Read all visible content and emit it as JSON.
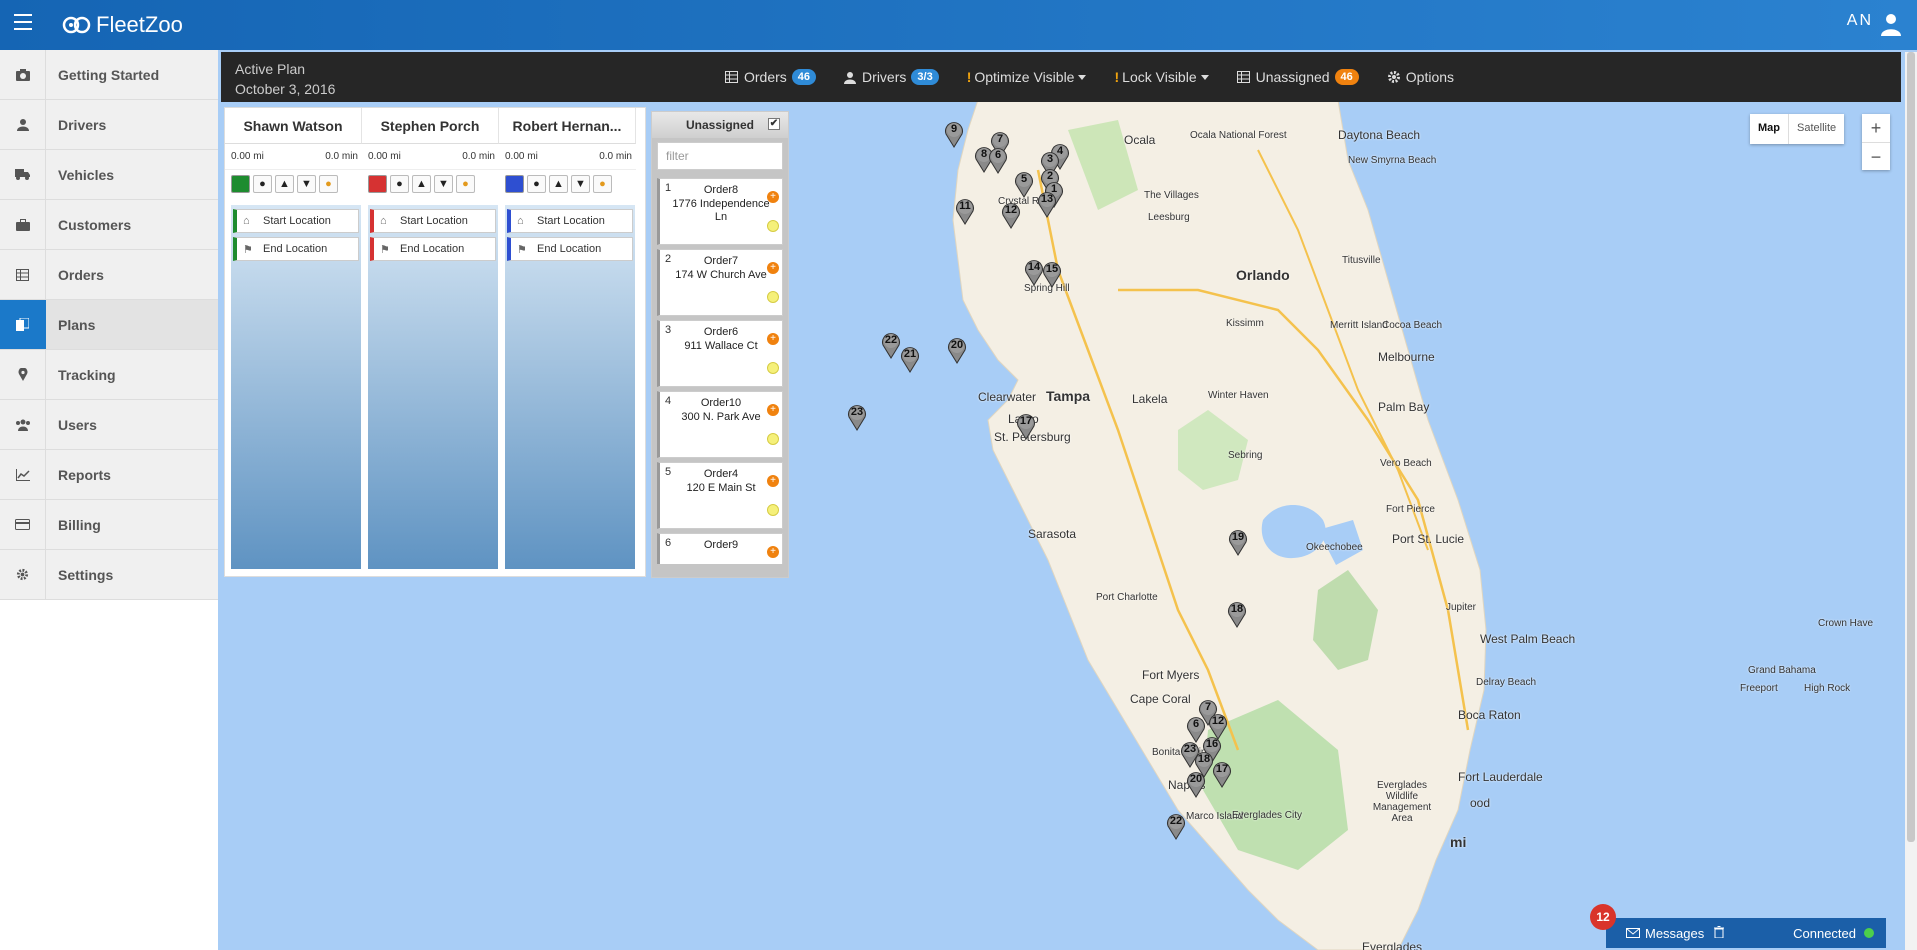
{
  "app": {
    "name": "FleetZoo",
    "user_initials": "AN"
  },
  "sidebar": {
    "items": [
      {
        "label": "Getting Started",
        "icon": "getting-started-icon",
        "active": false
      },
      {
        "label": "Drivers",
        "icon": "driver-icon",
        "active": false
      },
      {
        "label": "Vehicles",
        "icon": "truck-icon",
        "active": false
      },
      {
        "label": "Customers",
        "icon": "briefcase-icon",
        "active": false
      },
      {
        "label": "Orders",
        "icon": "grid-icon",
        "active": false
      },
      {
        "label": "Plans",
        "icon": "plans-icon",
        "active": true
      },
      {
        "label": "Tracking",
        "icon": "map-marker-icon",
        "active": false
      },
      {
        "label": "Users",
        "icon": "users-icon",
        "active": false
      },
      {
        "label": "Reports",
        "icon": "line-chart-icon",
        "active": false
      },
      {
        "label": "Billing",
        "icon": "credit-card-icon",
        "active": false
      },
      {
        "label": "Settings",
        "icon": "gear-icon",
        "active": false
      }
    ]
  },
  "planbar": {
    "title": "Active Plan",
    "date": "October 3, 2016",
    "orders_label": "Orders",
    "orders_count": "46",
    "drivers_label": "Drivers",
    "drivers_count": "3/3",
    "optimize_label": "Optimize Visible",
    "lock_label": "Lock Visible",
    "unassigned_label": "Unassigned",
    "unassigned_count": "46",
    "options_label": "Options"
  },
  "drivers": [
    {
      "name": "Shawn Watson",
      "distance": "0.00 mi",
      "time": "0.0 min",
      "color": "#1e8c2f",
      "start": "Start Location",
      "end": "End Location"
    },
    {
      "name": "Stephen Porch",
      "distance": "0.00 mi",
      "time": "0.0 min",
      "color": "#d63232",
      "start": "Start Location",
      "end": "End Location"
    },
    {
      "name": "Robert Hernan...",
      "distance": "0.00 mi",
      "time": "0.0 min",
      "color": "#2e4fd1",
      "start": "Start Location",
      "end": "End Location"
    }
  ],
  "unassigned": {
    "title": "Unassigned",
    "checkbox_mark": "✔",
    "filter_placeholder": "filter",
    "orders": [
      {
        "num": "1",
        "name": "Order8",
        "address": "1776 Independence Ln"
      },
      {
        "num": "2",
        "name": "Order7",
        "address": "174 W Church Ave"
      },
      {
        "num": "3",
        "name": "Order6",
        "address": "911 Wallace Ct"
      },
      {
        "num": "4",
        "name": "Order10",
        "address": "300 N. Park Ave"
      },
      {
        "num": "5",
        "name": "Order4",
        "address": "120 E Main St"
      },
      {
        "num": "6",
        "name": "Order9",
        "address": ""
      }
    ]
  },
  "map": {
    "type_map": "Map",
    "type_satellite": "Satellite",
    "zoom_in": "+",
    "zoom_out": "−",
    "labels": {
      "ocala": "Ocala",
      "ocala_nf": "Ocala National Forest",
      "daytona": "Daytona Beach",
      "new_smyrna": "New Smyrna Beach",
      "villages": "The Villages",
      "leesburg": "Leesburg",
      "crystal_river": "Crystal River",
      "orlando": "Orlando",
      "titusville": "Titusville",
      "spring_hill": "Spring Hill",
      "kissimmee": "Kissimm",
      "merritt": "Merritt Island",
      "cocoa": "Cocoa Beach",
      "melbourne": "Melbourne",
      "clearwater": "Clearwater",
      "tampa": "Tampa",
      "lakeland": "Lakela",
      "winter_haven": "Winter Haven",
      "largo": "Largo",
      "st_pete": "St. Petersburg",
      "palm_bay": "Palm Bay",
      "sebring": "Sebring",
      "vero": "Vero Beach",
      "sarasota": "Sarasota",
      "fort_pierce": "Fort Pierce",
      "port_st_lucie": "Port St. Lucie",
      "okeechobee": "Okeechobee",
      "port_charlotte": "Port Charlotte",
      "jupiter": "Jupiter",
      "west_palm": "West Palm Beach",
      "fort_myers": "Fort Myers",
      "cape_coral": "Cape Coral",
      "delray": "Delray Beach",
      "boca": "Boca Raton",
      "bonita": "Bonita Springs",
      "fort_lauderdale": "Fort Lauderdale",
      "naples": "Naples",
      "everglades_wma": "Everglades Wildlife Management Area",
      "marco": "Marco Island",
      "everglades_city": "Everglades City",
      "miami": "mi",
      "hollywood": "ood",
      "everglades_np": "Everglades",
      "crown_haven": "Crown Have",
      "grand_bahama": "Grand Bahama",
      "freeport": "Freeport",
      "high_rock": "High Rock"
    },
    "pins": [
      "9",
      "7",
      "4",
      "8",
      "6",
      "3",
      "5",
      "2",
      "1",
      "11",
      "12",
      "13",
      "14",
      "15",
      "22",
      "21",
      "20",
      "23",
      "17",
      "19",
      "18",
      "7",
      "6",
      "12",
      "23",
      "16",
      "18",
      "20",
      "17",
      "22"
    ]
  },
  "messages": {
    "count": "12",
    "label": "Messages",
    "status": "Connected"
  }
}
